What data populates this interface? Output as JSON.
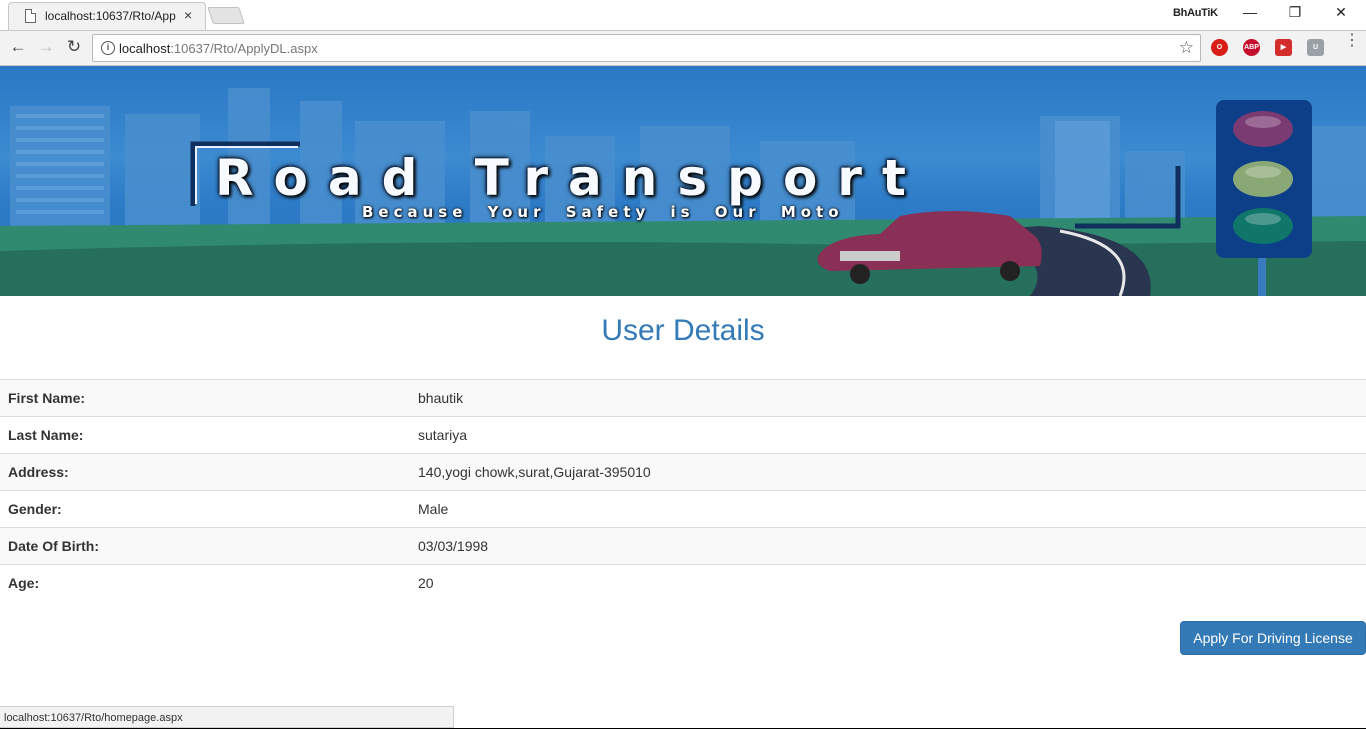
{
  "browser": {
    "tab_title": "localhost:10637/Rto/App",
    "tab_close": "×",
    "profile_name": "BhAuTiK",
    "window_controls": {
      "minimize": "—",
      "restore": "❐",
      "close": "✕"
    },
    "nav": {
      "back": "←",
      "forward": "→",
      "reload": "↻"
    },
    "address": {
      "host": "localhost",
      "rest": ":10637/Rto/ApplyDL.aspx"
    },
    "info_glyph": "i",
    "star_glyph": "☆",
    "extensions": [
      {
        "name": "opera-icon",
        "label": "O",
        "color": "#d91e18"
      },
      {
        "name": "adblock-icon",
        "label": "ABP",
        "color": "#c70d2c"
      },
      {
        "name": "media-icon",
        "label": "▶",
        "color": "#d42b2b"
      },
      {
        "name": "shield-icon",
        "label": "U",
        "color": "#9aa0a6"
      }
    ],
    "menu_glyph": "⋮",
    "status_url": "localhost:10637/Rto/homepage.aspx"
  },
  "banner": {
    "title": "Road Transport",
    "tagline": "Because Your Safety is Our Moto"
  },
  "page": {
    "heading": "User Details",
    "rows": [
      {
        "label": "First Name:",
        "value": "bhautik"
      },
      {
        "label": "Last Name:",
        "value": "sutariya"
      },
      {
        "label": "Address:",
        "value": "140,yogi chowk,surat,Gujarat-395010"
      },
      {
        "label": "Gender:",
        "value": "Male"
      },
      {
        "label": "Date Of Birth:",
        "value": "03/03/1998"
      },
      {
        "label": "Age:",
        "value": "20"
      }
    ],
    "apply_button": "Apply For Driving License"
  }
}
